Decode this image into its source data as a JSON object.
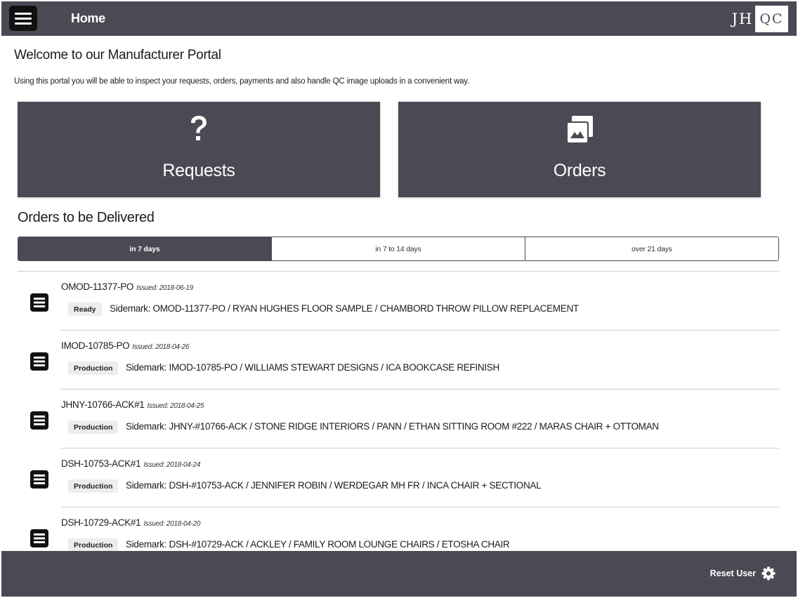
{
  "header": {
    "title": "Home",
    "logo": {
      "left": "JH",
      "right": "QC"
    }
  },
  "welcome": {
    "title": "Welcome to our Manufacturer Portal",
    "text": "Using this portal you will be able to inspect your requests, orders, payments and also handle QC image uploads in a convenient way."
  },
  "tiles": [
    {
      "label": "Requests",
      "icon": "question-mark-icon"
    },
    {
      "label": "Orders",
      "icon": "image-stack-icon"
    }
  ],
  "orders_section": {
    "title": "Orders to be Delivered",
    "tabs": [
      {
        "label": "in 7 days",
        "active": true
      },
      {
        "label": "in 7 to 14 days",
        "active": false
      },
      {
        "label": "over 21 days",
        "active": false
      }
    ],
    "orders": [
      {
        "id": "OMOD-11377-PO",
        "issued": "Issued: 2018-06-19",
        "status": "Ready",
        "sidemark": "Sidemark: OMOD-11377-PO / RYAN HUGHES FLOOR SAMPLE / CHAMBORD THROW PILLOW REPLACEMENT"
      },
      {
        "id": "IMOD-10785-PO",
        "issued": "Issued: 2018-04-26",
        "status": "Production",
        "sidemark": "Sidemark: IMOD-10785-PO / WILLIAMS STEWART DESIGNS / ICA BOOKCASE REFINISH"
      },
      {
        "id": "JHNY-10766-ACK#1",
        "issued": "Issued: 2018-04-25",
        "status": "Production",
        "sidemark": "Sidemark: JHNY-#10766-ACK / STONE RIDGE INTERIORS / PANN / ETHAN SITTING ROOM #222 / MARAS CHAIR + OTTOMAN"
      },
      {
        "id": "DSH-10753-ACK#1",
        "issued": "Issued: 2018-04-24",
        "status": "Production",
        "sidemark": "Sidemark: DSH-#10753-ACK / JENNIFER ROBIN / WERDEGAR MH FR / INCA CHAIR + SECTIONAL"
      },
      {
        "id": "DSH-10729-ACK#1",
        "issued": "Issued: 2018-04-20",
        "status": "Production",
        "sidemark": "Sidemark: DSH-#10729-ACK / ACKLEY / FAMILY ROOM LOUNGE CHAIRS / ETOSHA CHAIR"
      }
    ]
  },
  "footer": {
    "reset_label": "Reset User",
    "reset_icon": "gear-icon"
  },
  "colors": {
    "bar": "#4a4a55",
    "menu_button": "#111111",
    "badge_bg": "#ededed"
  }
}
